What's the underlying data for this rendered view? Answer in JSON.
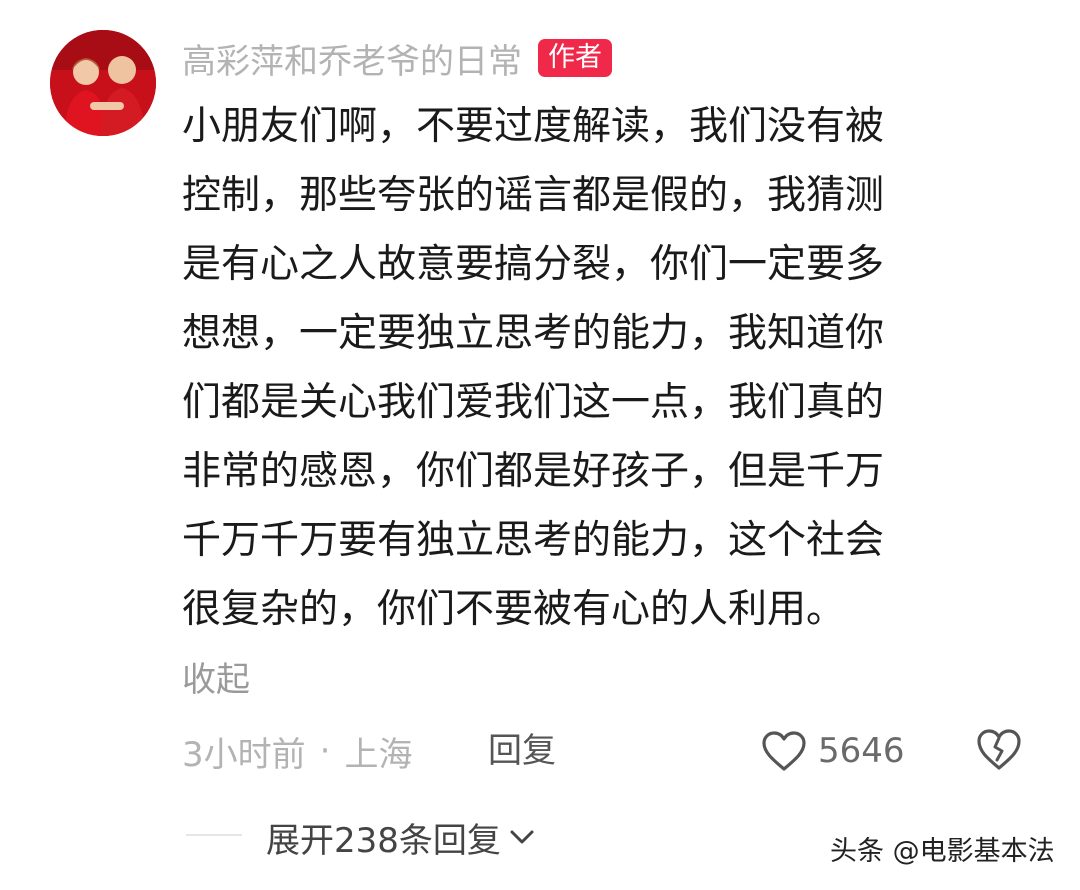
{
  "comment": {
    "author_name": "高彩萍和乔老爷的日常",
    "author_badge": "作者",
    "lines": [
      "小朋友们啊，不要过度解读，我们没有被",
      "控制，那些夸张的谣言都是假的，我猜测",
      "是有心之人故意要搞分裂，你们一定要多",
      "想想，一定要独立思考的能力，我知道你",
      "们都是关心我们爱我们这一点，我们真的",
      "非常的感恩，你们都是好孩子，但是千万",
      "千万千万要有独立思考的能力，这个社会",
      "很复杂的，你们不要被有心的人利用。"
    ],
    "collapse_label": "收起",
    "time": "3小时前",
    "separator": "·",
    "location": "上海",
    "reply_label": "回复",
    "like_count": "5646",
    "expand_replies_label": "展开238条回复"
  },
  "watermark": "头条 @电影基本法",
  "colors": {
    "badge": "#f02849",
    "avatar_bg": "#c8101a",
    "muted": "#b3b3b3",
    "body_text": "#1a1a1a"
  },
  "icons": {
    "like": "heart-outline-icon",
    "dislike": "broken-heart-icon",
    "expand": "chevron-down-icon"
  }
}
